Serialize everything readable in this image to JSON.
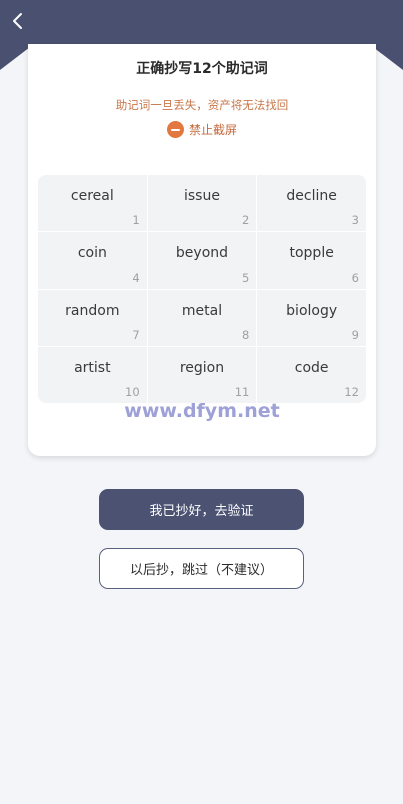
{
  "header": {
    "back_icon": "chevron-left-icon"
  },
  "card": {
    "title": "正确抄写12个助记词",
    "warning": "助记词一旦丢失，资产将无法找回",
    "no_screenshot": "禁止截屏",
    "no_screenshot_icon": "minus-circle-icon"
  },
  "words": [
    {
      "word": "cereal",
      "num": "1"
    },
    {
      "word": "issue",
      "num": "2"
    },
    {
      "word": "decline",
      "num": "3"
    },
    {
      "word": "coin",
      "num": "4"
    },
    {
      "word": "beyond",
      "num": "5"
    },
    {
      "word": "topple",
      "num": "6"
    },
    {
      "word": "random",
      "num": "7"
    },
    {
      "word": "metal",
      "num": "8"
    },
    {
      "word": "biology",
      "num": "9"
    },
    {
      "word": "artist",
      "num": "10"
    },
    {
      "word": "region",
      "num": "11"
    },
    {
      "word": "code",
      "num": "12"
    }
  ],
  "watermark": "www.dfym.net",
  "buttons": {
    "verify": "我已抄好，去验证",
    "skip": "以后抄，跳过（不建议）"
  },
  "colors": {
    "header": "#4a5170",
    "warning": "#c9774a",
    "icon": "#e2773f"
  }
}
